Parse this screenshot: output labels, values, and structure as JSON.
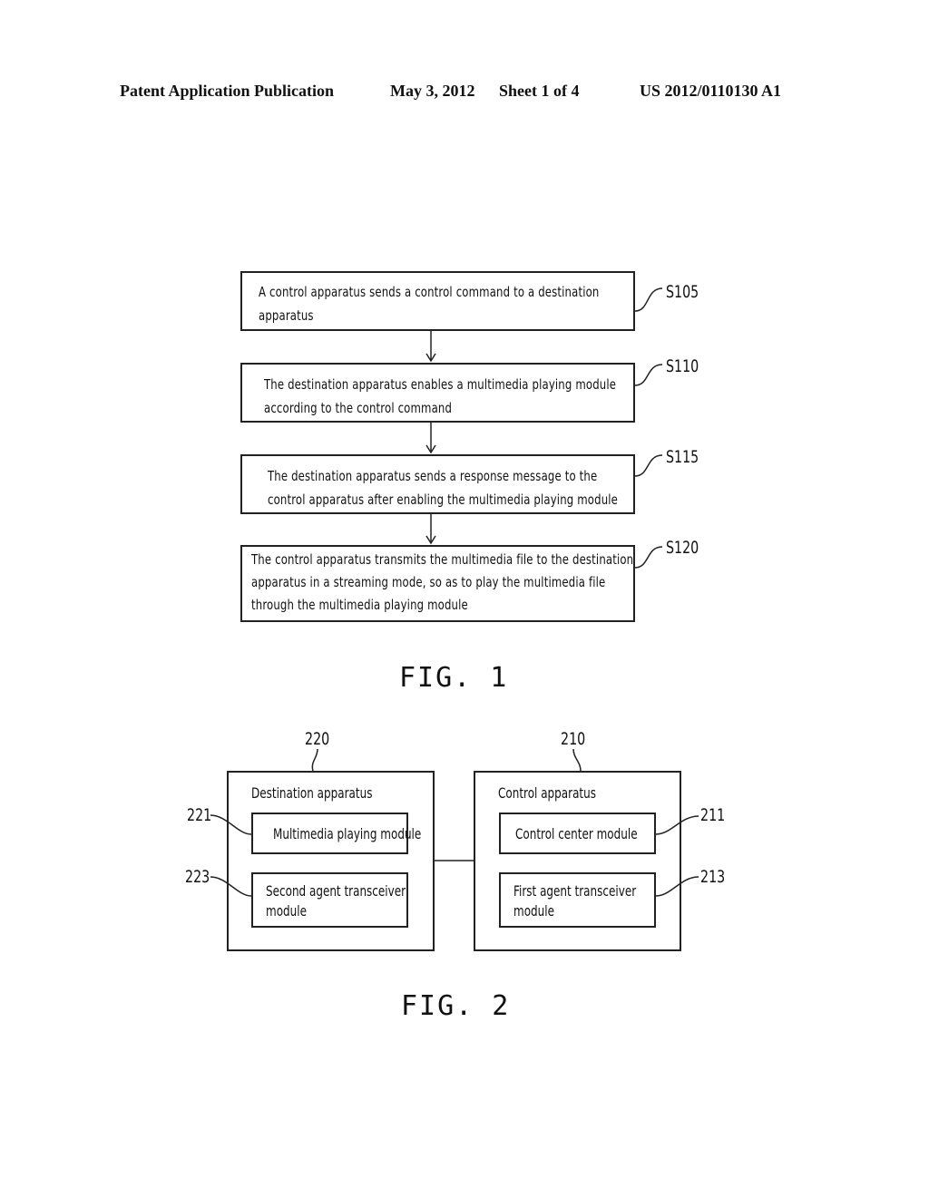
{
  "header": {
    "publication_type": "Patent Application Publication",
    "date": "May 3, 2012",
    "sheet": "Sheet 1 of 4",
    "publication_number": "US 2012/0110130 A1"
  },
  "fig1": {
    "caption": "FIG. 1",
    "steps": [
      {
        "label": "S105",
        "lines": [
          "A control apparatus sends a control command to a destination",
          "apparatus"
        ]
      },
      {
        "label": "S110",
        "lines": [
          "The destination apparatus enables a multimedia playing module",
          "according to the control command"
        ]
      },
      {
        "label": "S115",
        "lines": [
          "The destination apparatus sends a response message to the",
          "control apparatus after enabling the multimedia playing module"
        ]
      },
      {
        "label": "S120",
        "lines": [
          "The control apparatus transmits the multimedia file to the destination",
          "apparatus in a streaming mode, so as to play the multimedia file",
          "through the multimedia playing module"
        ]
      }
    ]
  },
  "fig2": {
    "caption": "FIG. 2",
    "destination": {
      "ref": "220",
      "title": "Destination apparatus",
      "modules": [
        {
          "ref": "221",
          "lines": [
            "Multimedia playing module"
          ]
        },
        {
          "ref": "223",
          "lines": [
            "Second agent transceiver",
            "module"
          ]
        }
      ]
    },
    "control": {
      "ref": "210",
      "title": "Control apparatus",
      "modules": [
        {
          "ref": "211",
          "lines": [
            "Control center module"
          ]
        },
        {
          "ref": "213",
          "lines": [
            "First agent transceiver",
            "module"
          ]
        }
      ]
    }
  }
}
